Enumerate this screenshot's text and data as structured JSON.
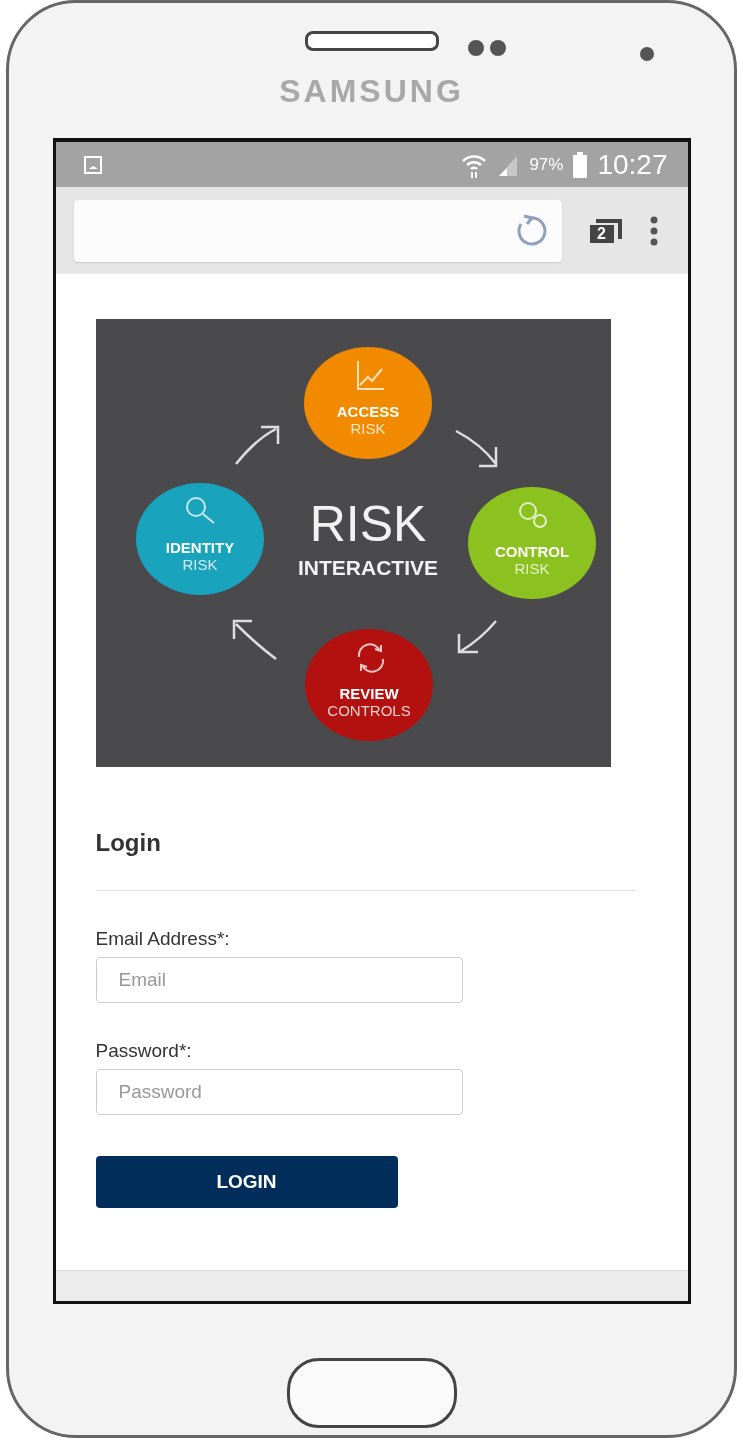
{
  "device": {
    "brand": "SAMSUNG"
  },
  "status_bar": {
    "battery": "97%",
    "time": "10:27"
  },
  "browser": {
    "tab_count": "2"
  },
  "hero_graphic": {
    "title": "RISK",
    "subtitle": "INTERACTIVE",
    "nodes": [
      {
        "kind": "access",
        "line1": "ACCESS",
        "line2": "RISK",
        "color": "#f28a00"
      },
      {
        "kind": "identity",
        "line1": "IDENTITY",
        "line2": "RISK",
        "color": "#1aa3bd"
      },
      {
        "kind": "control",
        "line1": "CONTROL",
        "line2": "RISK",
        "color": "#8cc21f"
      },
      {
        "kind": "review",
        "line1": "REVIEW",
        "line2": "CONTROLS",
        "color": "#b3110f"
      }
    ]
  },
  "login": {
    "heading": "Login",
    "fields": [
      {
        "label": "Email Address*:",
        "placeholder": "Email"
      },
      {
        "label": "Password*:",
        "placeholder": "Password"
      }
    ],
    "button": "LOGIN"
  }
}
